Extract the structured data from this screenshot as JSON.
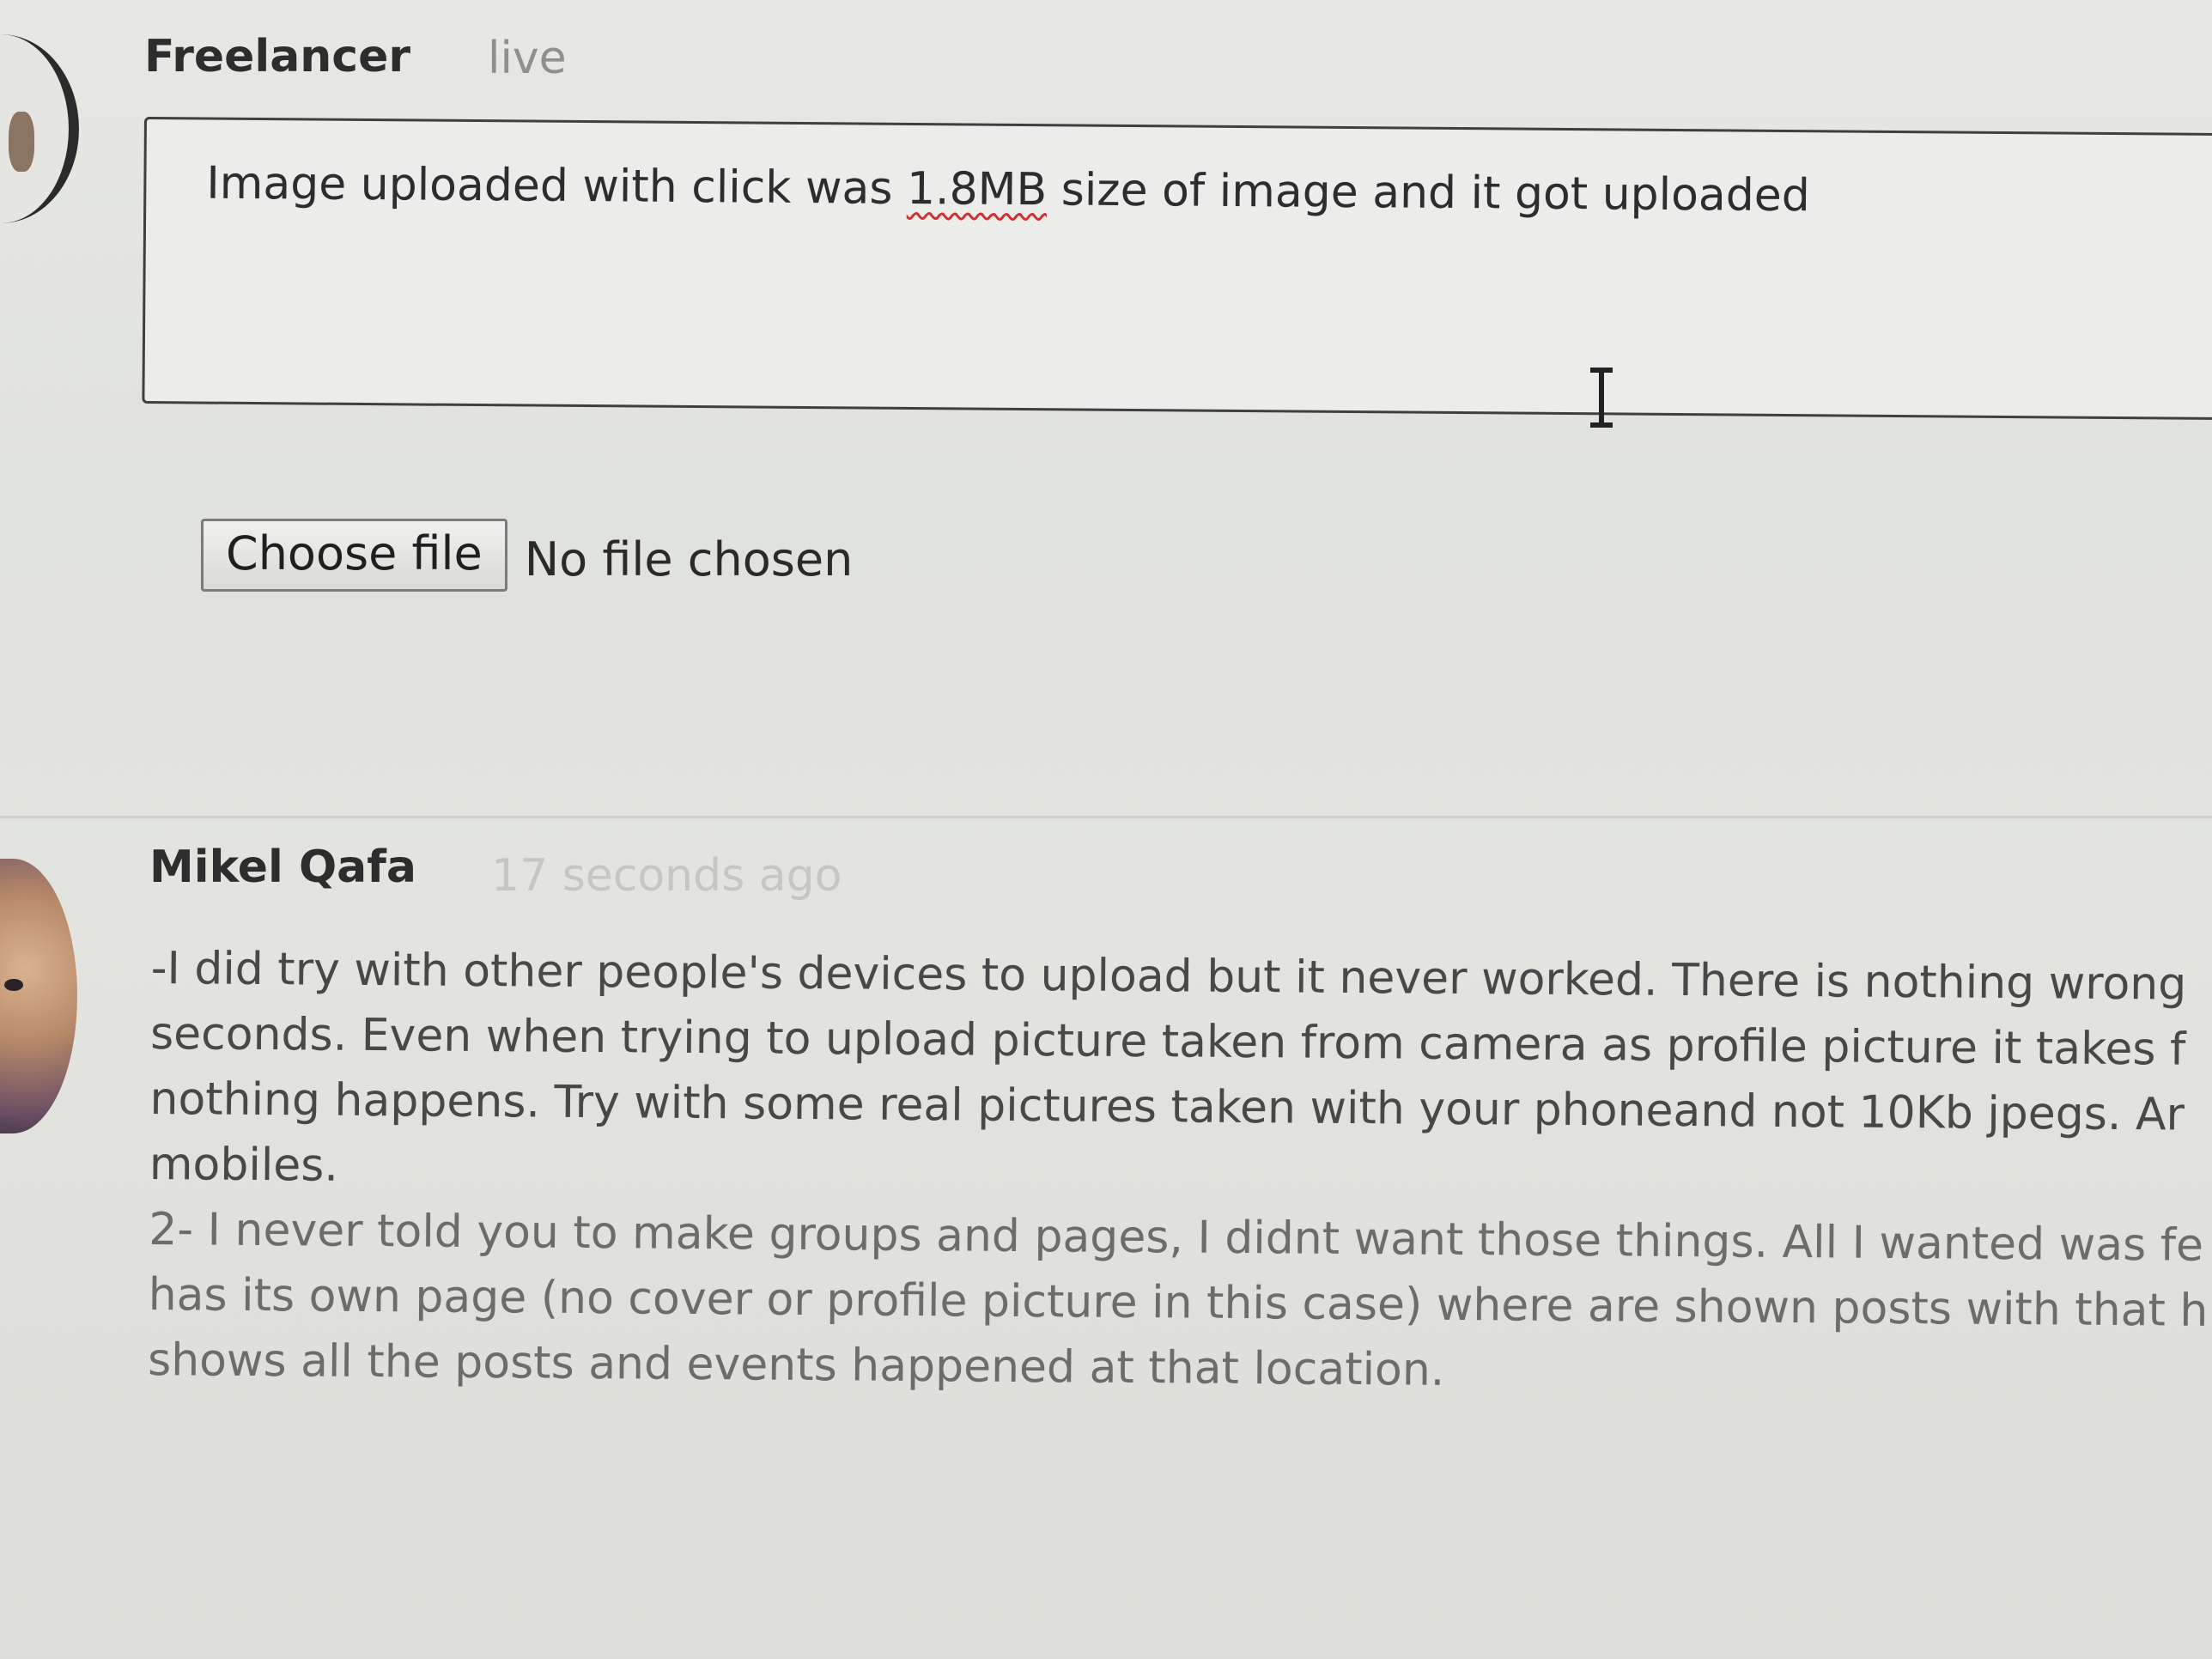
{
  "reply": {
    "username": "Freelancer",
    "status": "live",
    "textarea_before": "Image uploaded with click was ",
    "textarea_misspelled": "1.8MB",
    "textarea_after": " size of image and it got uploaded",
    "choose_file_label": "Choose file",
    "file_status": "No file chosen"
  },
  "post": {
    "username": "Mikel Qafa",
    "timestamp": "17 seconds ago",
    "lines": [
      "-I did try with other people's devices to upload but it never worked. There is nothing wrong",
      "seconds. Even when trying to upload picture taken from camera as profile picture it takes f",
      "nothing happens. Try with some real pictures taken with your phoneand not 10Kb jpegs. Ar",
      "mobiles.",
      "2- I never told you to make groups and pages, I didnt want those things. All I wanted was fe",
      "has its own page (no cover or profile picture in this case) where are shown posts with that h",
      "shows all the posts and events happened at that location."
    ]
  }
}
